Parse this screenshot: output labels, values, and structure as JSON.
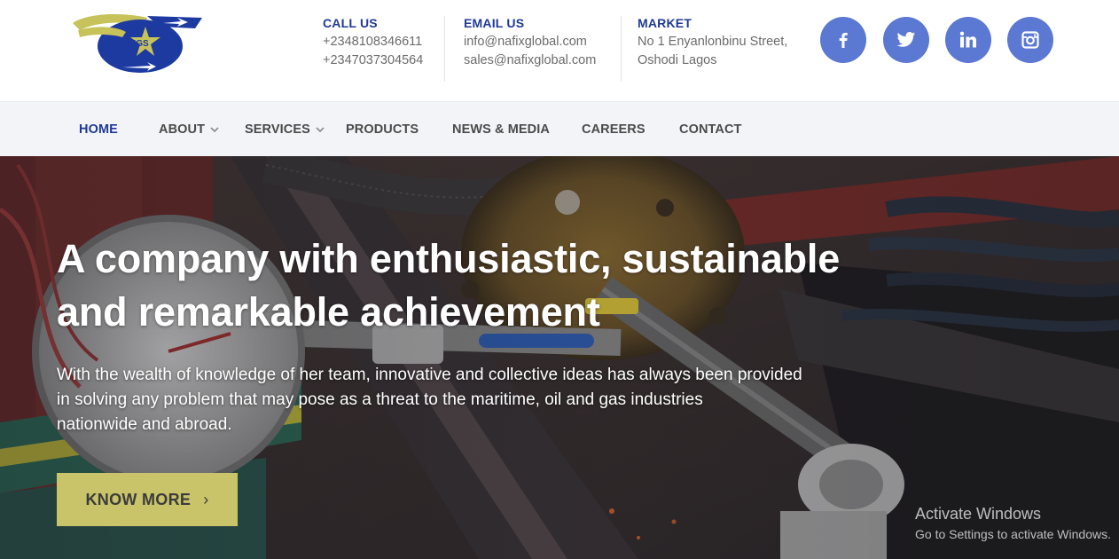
{
  "header": {
    "logo_text": "NGS",
    "call": {
      "heading": "CALL US",
      "lines": [
        "+2348108346611",
        "+2347037304564"
      ]
    },
    "email": {
      "heading": "EMAIL US",
      "lines": [
        "info@nafixglobal.com",
        "sales@nafixglobal.com"
      ]
    },
    "market": {
      "heading": "MARKET",
      "lines": [
        "No 1 Enyanlonbinu Street,",
        "Oshodi Lagos"
      ]
    },
    "social": [
      "facebook-icon",
      "twitter-icon",
      "linkedin-icon",
      "instagram-icon"
    ]
  },
  "nav": {
    "items": [
      {
        "label": "HOME",
        "active": true,
        "dropdown": false
      },
      {
        "label": "ABOUT",
        "active": false,
        "dropdown": true
      },
      {
        "label": "SERVICES",
        "active": false,
        "dropdown": true
      },
      {
        "label": "PRODUCTS",
        "active": false,
        "dropdown": false
      },
      {
        "label": "NEWS & MEDIA",
        "active": false,
        "dropdown": false
      },
      {
        "label": "CAREERS",
        "active": false,
        "dropdown": false
      },
      {
        "label": "CONTACT",
        "active": false,
        "dropdown": false
      }
    ]
  },
  "hero": {
    "title_line1": "A company with enthusiastic, sustainable",
    "title_line2": "and remarkable achievement",
    "text_line1": "With the wealth of knowledge of her team, innovative and collective ideas has always been provided",
    "text_line2": "in solving any problem that may pose as a threat to the maritime, oil and gas industries",
    "text_line3": "nationwide and abroad.",
    "cta_label": "KNOW MORE",
    "cta_icon": "chevron-right-icon"
  },
  "watermark": {
    "line1": "Activate Windows",
    "line2": "Go to Settings to activate Windows."
  },
  "colors": {
    "brand_blue": "#1f3a93",
    "social_bg": "#5b78d2",
    "cta_bg": "#c9c46a",
    "nav_bg": "#f3f4f8"
  }
}
